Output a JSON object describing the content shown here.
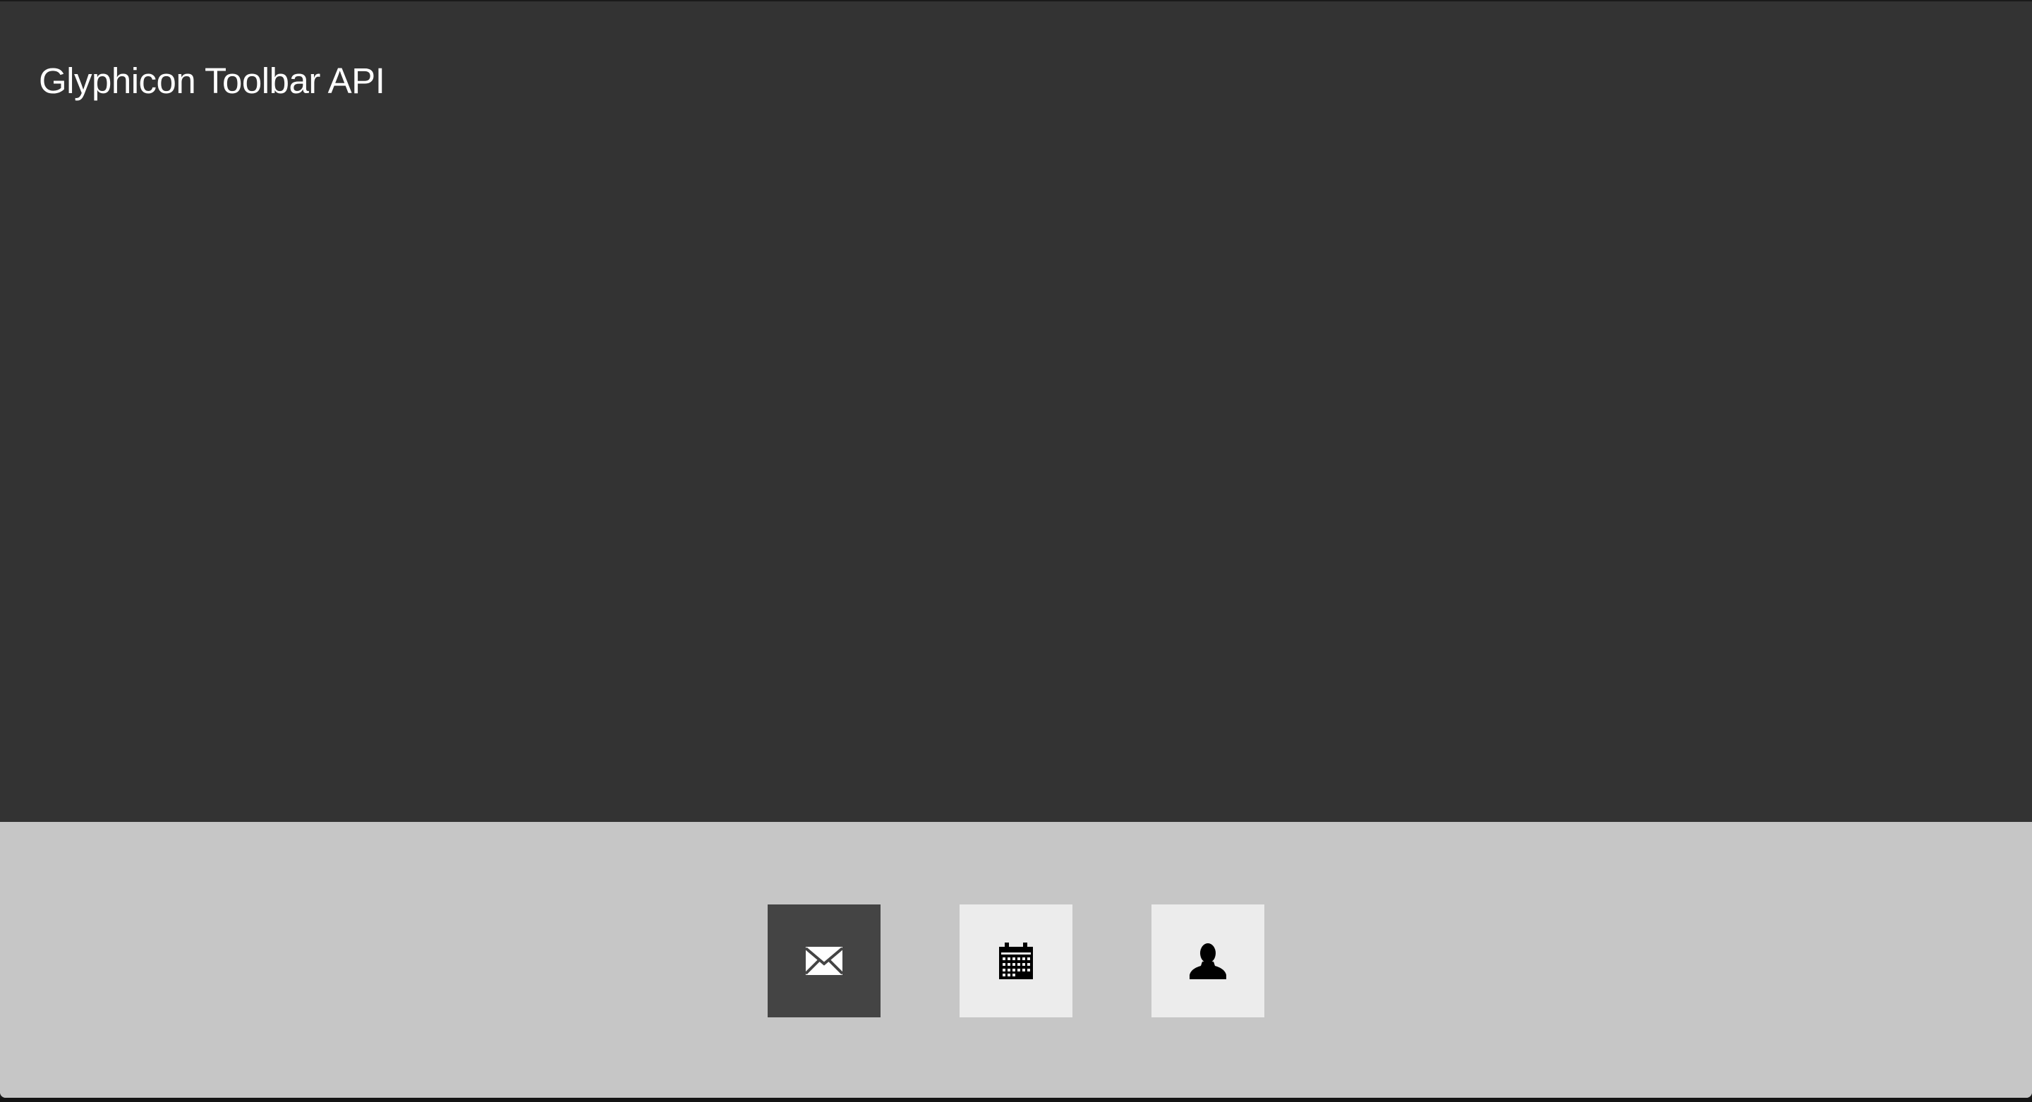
{
  "page": {
    "title": "Glyphicon Toolbar API"
  },
  "toolbar": {
    "buttons": [
      {
        "id": "mail",
        "icon": "envelope-icon",
        "state": "active"
      },
      {
        "id": "calendar",
        "icon": "calendar-icon",
        "state": "inactive"
      },
      {
        "id": "user",
        "icon": "user-icon",
        "state": "inactive"
      }
    ]
  },
  "colors": {
    "content_background": "#333333",
    "toolbar_background": "#c6c6c6",
    "button_active": "#444444",
    "button_inactive": "#ececec",
    "title_text": "#ffffff"
  }
}
